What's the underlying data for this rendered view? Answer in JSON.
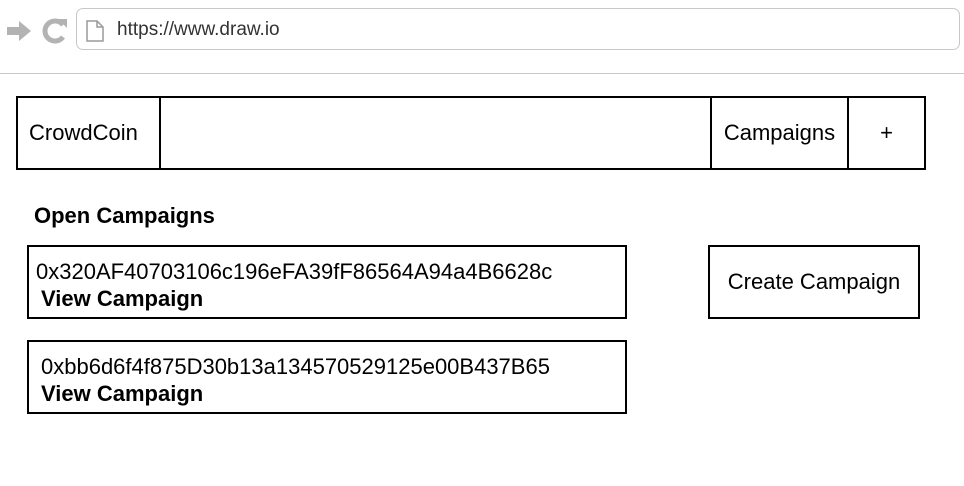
{
  "browser": {
    "url": "https://www.draw.io"
  },
  "menu": {
    "logo": "CrowdCoin",
    "campaigns": "Campaigns",
    "add": "+"
  },
  "main": {
    "heading": "Open Campaigns",
    "campaigns": [
      {
        "address": "0x320AF40703106c196eFA39fF86564A94a4B6628c",
        "link": "View Campaign"
      },
      {
        "address": "0xbb6d6f4f875D30b13a134570529125e00B437B65",
        "link": "View Campaign"
      }
    ],
    "create_button": "Create Campaign"
  },
  "colors": {
    "browser_icon": "#b3b3b3",
    "border": "#000000"
  }
}
